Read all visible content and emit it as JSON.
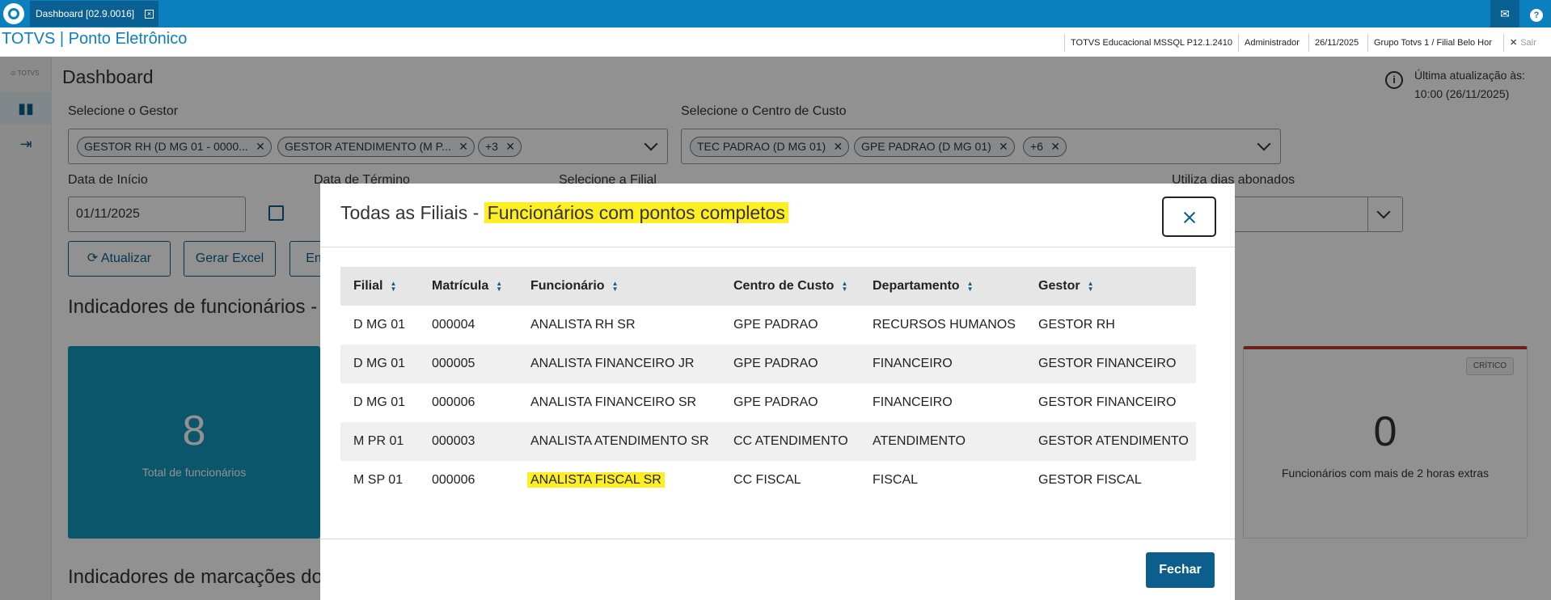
{
  "window": {
    "tab_label": "Dashboard [02.9.0016]",
    "close_tab": "×"
  },
  "header": {
    "app_title": "TOTVS | Ponto Eletrônico",
    "environment": "TOTVS Educacional MSSQL P12.1.2410",
    "user": "Administrador",
    "date": "26/11/2025",
    "branch": "Grupo Totvs 1 / Filial Belo Hor",
    "logout_label": "Sair"
  },
  "sidebar": {
    "logo_text": "TOTVS",
    "items": [
      {
        "icon": "bar-chart-icon"
      },
      {
        "icon": "logout-icon"
      }
    ]
  },
  "background": {
    "page_title": "Dashboard",
    "last_update_label": "Última atualização às:",
    "last_update_value": "10:00 (26/11/2025)",
    "gestor_label": "Selecione o Gestor",
    "gestor_chips": [
      "GESTOR RH (D MG 01 - 0000...",
      "GESTOR ATENDIMENTO (M P...",
      "+3"
    ],
    "cc_label": "Selecione o Centro de Custo",
    "cc_chips": [
      "TEC PADRAO (D MG 01)",
      "GPE PADRAO (D MG 01)",
      "+6"
    ],
    "data_inicio_label": "Data de Início",
    "data_inicio_value": "01/11/2025",
    "data_termino_label": "Data de Término",
    "filial_label": "Selecione a Filial",
    "abonados_label": "Utiliza dias abonados",
    "atualizar_label": "Atualizar",
    "gerar_excel_label": "Gerar Excel",
    "third_btn_label": "En",
    "indicadores_funcionarios": "Indicadores de funcionários -",
    "indicadores_marcacoes": "Indicadores de marcações do",
    "kpi_total_value": "8",
    "kpi_total_label": "Total de funcionários",
    "kpi_extra_value": "0",
    "kpi_extra_label": "Funcionários com mais de 2 horas extras",
    "kpi_extra_badge": "CRÍTICO"
  },
  "modal": {
    "title_prefix": "Todas as Filiais - ",
    "title_highlight": "Funcionários com pontos completos",
    "columns": [
      "Filial",
      "Matrícula",
      "Funcionário",
      "Centro de Custo",
      "Departamento",
      "Gestor"
    ],
    "rows": [
      [
        "D MG 01",
        "000004",
        "ANALISTA RH SR",
        "GPE PADRAO",
        "RECURSOS HUMANOS",
        "GESTOR RH"
      ],
      [
        "D MG 01",
        "000005",
        "ANALISTA FINANCEIRO JR",
        "GPE PADRAO",
        "FINANCEIRO",
        "GESTOR FINANCEIRO"
      ],
      [
        "D MG 01",
        "000006",
        "ANALISTA FINANCEIRO SR",
        "GPE PADRAO",
        "FINANCEIRO",
        "GESTOR FINANCEIRO"
      ],
      [
        "M PR 01",
        "000003",
        "ANALISTA ATENDIMENTO SR",
        "CC ATENDIMENTO",
        "ATENDIMENTO",
        "GESTOR ATENDIMENTO"
      ],
      [
        "M SP 01",
        "000006",
        "ANALISTA FISCAL SR",
        "CC FISCAL",
        "FISCAL",
        "GESTOR FISCAL"
      ]
    ],
    "close_button_label": "Fechar"
  }
}
